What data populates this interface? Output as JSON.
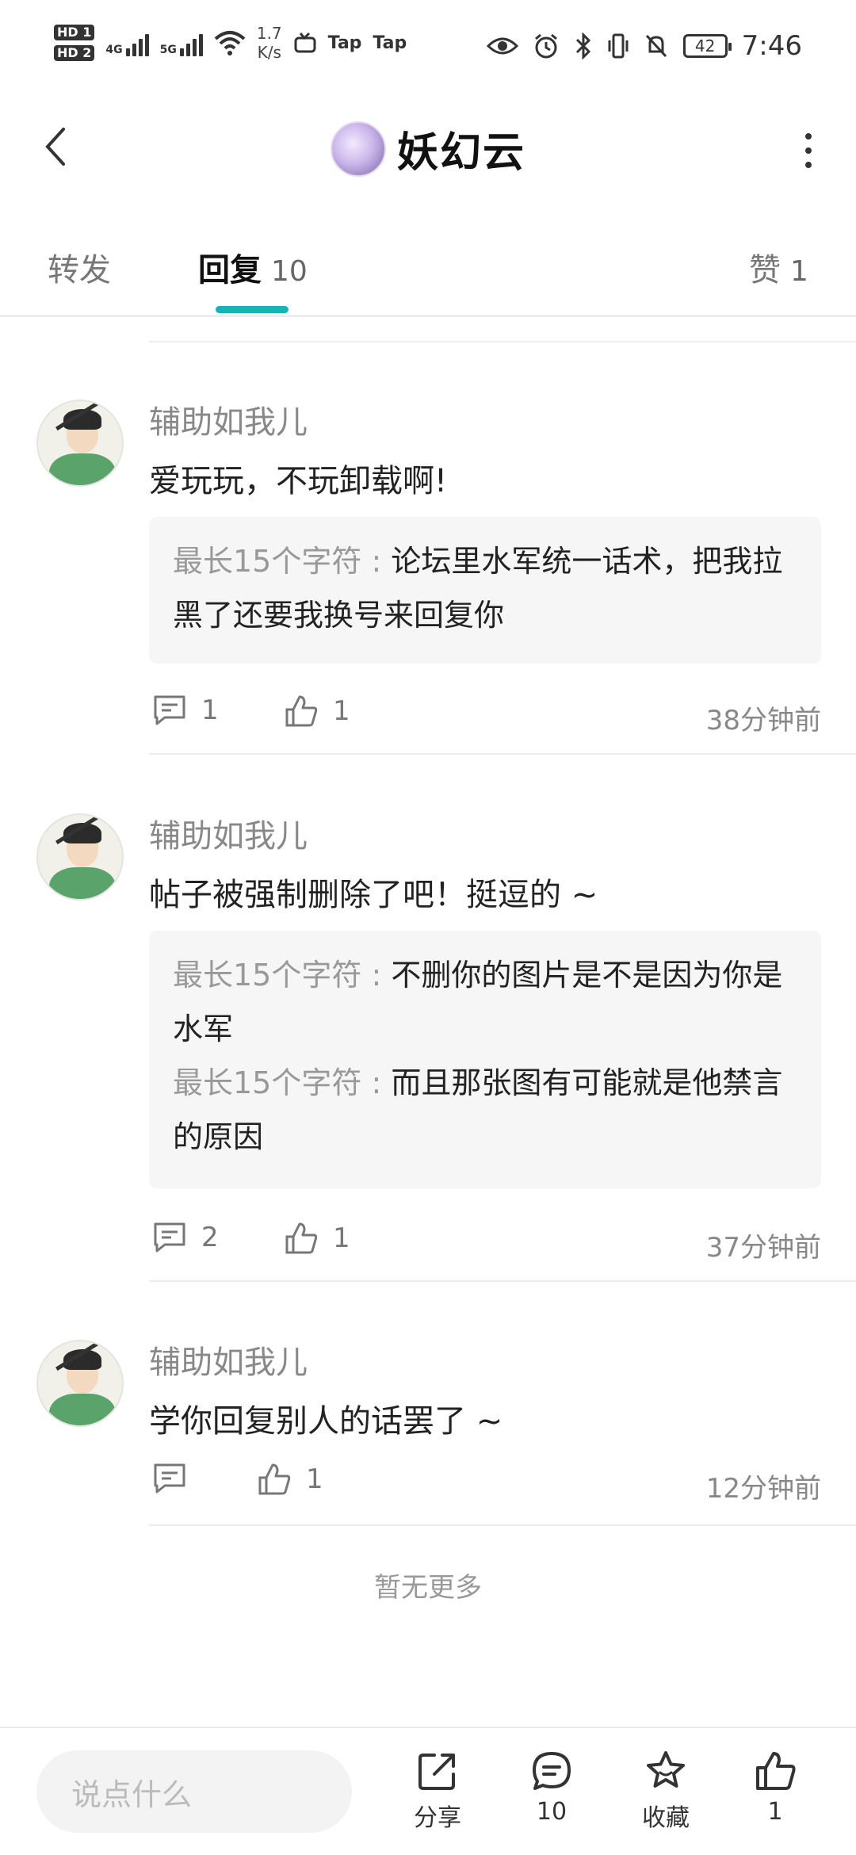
{
  "status_bar": {
    "hd1": "HD 1",
    "hd2": "HD 2",
    "net1": "4G",
    "net2": "5G",
    "speed_value": "1.7",
    "speed_unit": "K/s",
    "app1": "Tap",
    "app2": "Tap",
    "battery": "42",
    "time": "7:46"
  },
  "header": {
    "title": "妖幻云"
  },
  "tabs": [
    {
      "label": "转发",
      "count": ""
    },
    {
      "label": "回复",
      "count": "10"
    },
    {
      "label": "赞",
      "count": "1"
    }
  ],
  "comments": [
    {
      "author": "辅助如我儿",
      "content": "爱玩玩，不玩卸载啊!",
      "quotes": [
        {
          "name": "最长15个字符",
          "sep": " : ",
          "text": "论坛里水军统一话术，把我拉黑了还要我换号来回复你"
        }
      ],
      "reply_count": "1",
      "like_count": "1",
      "time": "38分钟前"
    },
    {
      "author": "辅助如我儿",
      "content": "帖子被强制删除了吧！挺逗的 ~",
      "quotes": [
        {
          "name": "最长15个字符",
          "sep": " : ",
          "text": "不删你的图片是不是因为你是水军"
        },
        {
          "name": "最长15个字符",
          "sep": " : ",
          "text": "而且那张图有可能就是他禁言的原因"
        }
      ],
      "reply_count": "2",
      "like_count": "1",
      "time": "37分钟前"
    },
    {
      "author": "辅助如我儿",
      "content": "学你回复别人的话罢了 ~",
      "quotes": [],
      "reply_count": "",
      "like_count": "1",
      "time": "12分钟前"
    }
  ],
  "no_more": "暂无更多",
  "bottom_bar": {
    "input_placeholder": "说点什么",
    "share_label": "分享",
    "comment_count": "10",
    "favorite_label": "收藏",
    "like_count": "1"
  },
  "colors": {
    "accent": "#16b3b9",
    "muted": "#888888"
  }
}
